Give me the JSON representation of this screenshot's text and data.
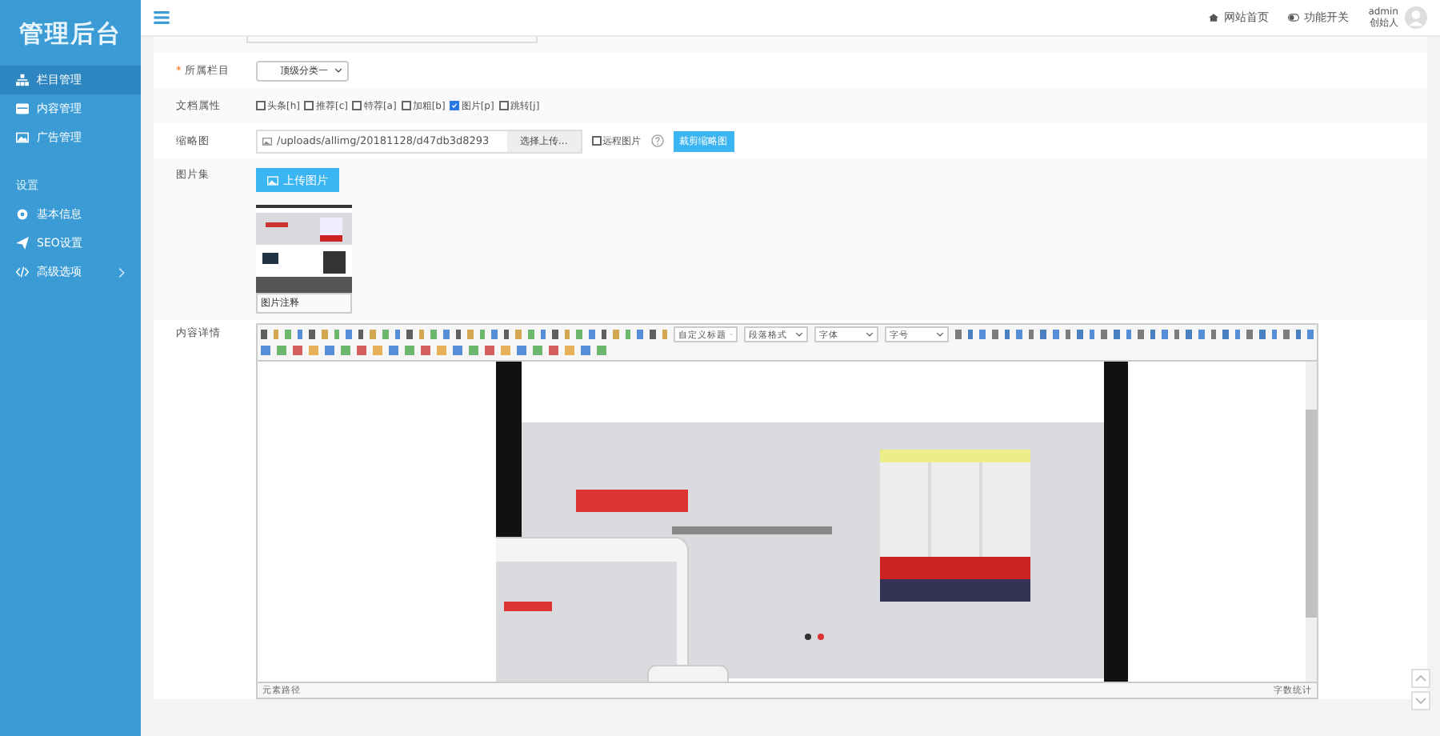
{
  "sidebar": {
    "logo": "管理后台",
    "groups": [
      {
        "items": [
          {
            "label": "栏目管理",
            "selected": true,
            "has_children": false
          },
          {
            "label": "内容管理",
            "selected": false,
            "has_children": false
          },
          {
            "label": "广告管理",
            "selected": false,
            "has_children": false
          }
        ]
      },
      {
        "title": "设置",
        "items": [
          {
            "label": "基本信息",
            "selected": false,
            "has_children": false
          },
          {
            "label": "SEO设置",
            "selected": false,
            "has_children": false
          },
          {
            "label": "高级选项",
            "selected": false,
            "has_children": true
          }
        ]
      }
    ]
  },
  "topbar": {
    "links": [
      {
        "label": "网站首页"
      },
      {
        "label": "功能开关"
      }
    ],
    "user": {
      "name": "admin",
      "role": "创始人"
    }
  },
  "form": {
    "category": {
      "label": "所属栏目",
      "required_mark": "*",
      "value": "顶级分类一"
    },
    "attributes": {
      "label": "文档属性",
      "options": [
        {
          "label": "头条[h]",
          "checked": false
        },
        {
          "label": "推荐[c]",
          "checked": false
        },
        {
          "label": "特荐[a]",
          "checked": false
        },
        {
          "label": "加粗[b]",
          "checked": false
        },
        {
          "label": "图片[p]",
          "checked": true
        },
        {
          "label": "跳转[j]",
          "checked": false
        }
      ]
    },
    "thumbnail": {
      "label": "缩略图",
      "value": "/uploads/allimg/20181128/d47db3d8293",
      "browse": "选择上传...",
      "remote": {
        "label": "远程图片",
        "checked": false
      },
      "crop": "裁剪缩略图"
    },
    "gallery": {
      "label": "图片集",
      "upload": "上传图片",
      "caption": "图片注释"
    },
    "content": {
      "label": "内容详情",
      "selects": [
        "自定义标题",
        "段落格式",
        "字体",
        "字号"
      ],
      "status_left": "元素路径",
      "status_right": "字数统计"
    }
  }
}
